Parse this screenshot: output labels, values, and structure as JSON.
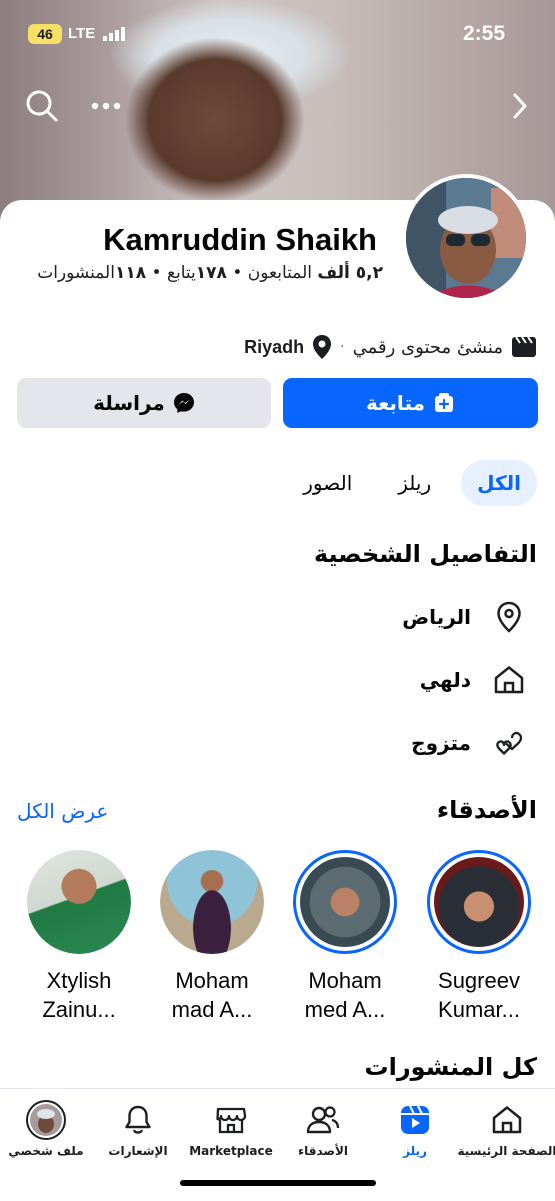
{
  "status_bar": {
    "battery": "46",
    "network": "LTE",
    "time": "2:55"
  },
  "profile": {
    "name": "Kamruddin Shaikh",
    "stats": {
      "followers_value": "٥,٢ ألف",
      "followers_label": "المتابعون",
      "following_value": "١٧٨",
      "following_label": "يتابع",
      "posts_value": "١١٨",
      "posts_label": "المنشورات",
      "separator": "•"
    },
    "category": "منشئ محتوى رقمي",
    "location": "Riyadh"
  },
  "actions": {
    "follow_label": "متابعة",
    "message_label": "مراسلة"
  },
  "tabs": [
    {
      "label": "الكل",
      "active": true
    },
    {
      "label": "ريلز",
      "active": false
    },
    {
      "label": "الصور",
      "active": false
    }
  ],
  "details": {
    "title": "التفاصيل الشخصية",
    "items": [
      {
        "icon": "location-pin-icon",
        "text": "الرياض"
      },
      {
        "icon": "home-icon",
        "text": "دلهي"
      },
      {
        "icon": "hearts-icon",
        "text": "متزوج"
      }
    ]
  },
  "friends": {
    "title": "الأصدقاء",
    "see_all": "عرض الكل",
    "items": [
      {
        "name": "Sugreev Kumar...",
        "line1": "Sugreev",
        "line2": "Kumar...",
        "story": true
      },
      {
        "name": "Mohammed A...",
        "line1": "Moham",
        "line2": "med A...",
        "story": true
      },
      {
        "name": "Mohammad A...",
        "line1": "Moham",
        "line2": "mad A...",
        "story": false
      },
      {
        "name": "Xtylish Zainu...",
        "line1": "Xtylish",
        "line2": "Zainu...",
        "story": false
      }
    ]
  },
  "posts": {
    "title": "كل المنشورات"
  },
  "nav": {
    "home": "الصفحة الرئيسية",
    "reels": "ريلز",
    "friends": "الأصدقاء",
    "marketplace": "Marketplace",
    "notifications": "الإشعارات",
    "profile": "ملف شخصي"
  },
  "colors": {
    "accent": "#0866ff",
    "secondary_button": "#e4e6eb",
    "active_tab_bg": "#e7f0fe"
  }
}
